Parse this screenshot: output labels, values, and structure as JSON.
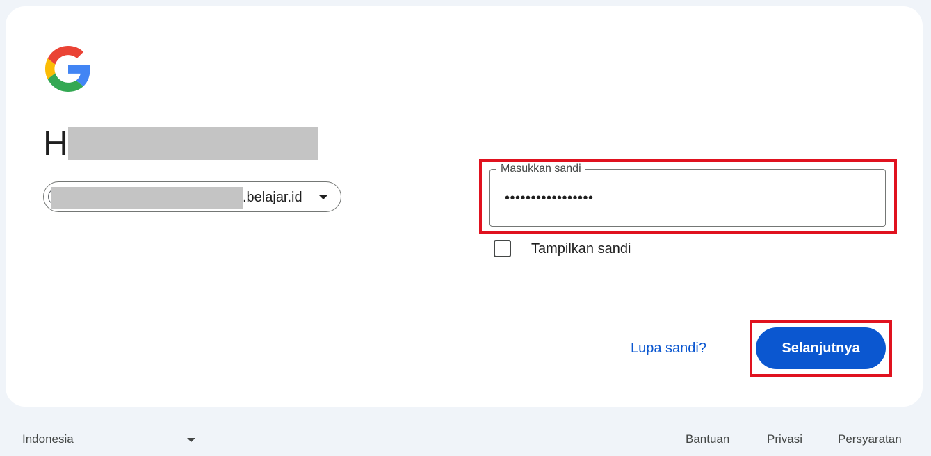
{
  "greeting": {
    "visible_text": "H"
  },
  "account_chip": {
    "email_domain": ".belajar.id"
  },
  "password": {
    "label": "Masukkan sandi",
    "masked_value": "•••••••••••••••••"
  },
  "show_password": {
    "label": "Tampilkan sandi",
    "checked": false
  },
  "actions": {
    "forgot_label": "Lupa sandi?",
    "next_label": "Selanjutnya"
  },
  "footer": {
    "language": "Indonesia",
    "links": [
      "Bantuan",
      "Privasi",
      "Persyaratan"
    ]
  },
  "colors": {
    "primary": "#0b57d0",
    "highlight": "#e0121f",
    "background": "#f0f4f9",
    "redaction": "#c4c4c4"
  },
  "icons": [
    "google-g-logo-icon",
    "avatar-icon",
    "chevron-down-icon",
    "checkbox-icon"
  ]
}
